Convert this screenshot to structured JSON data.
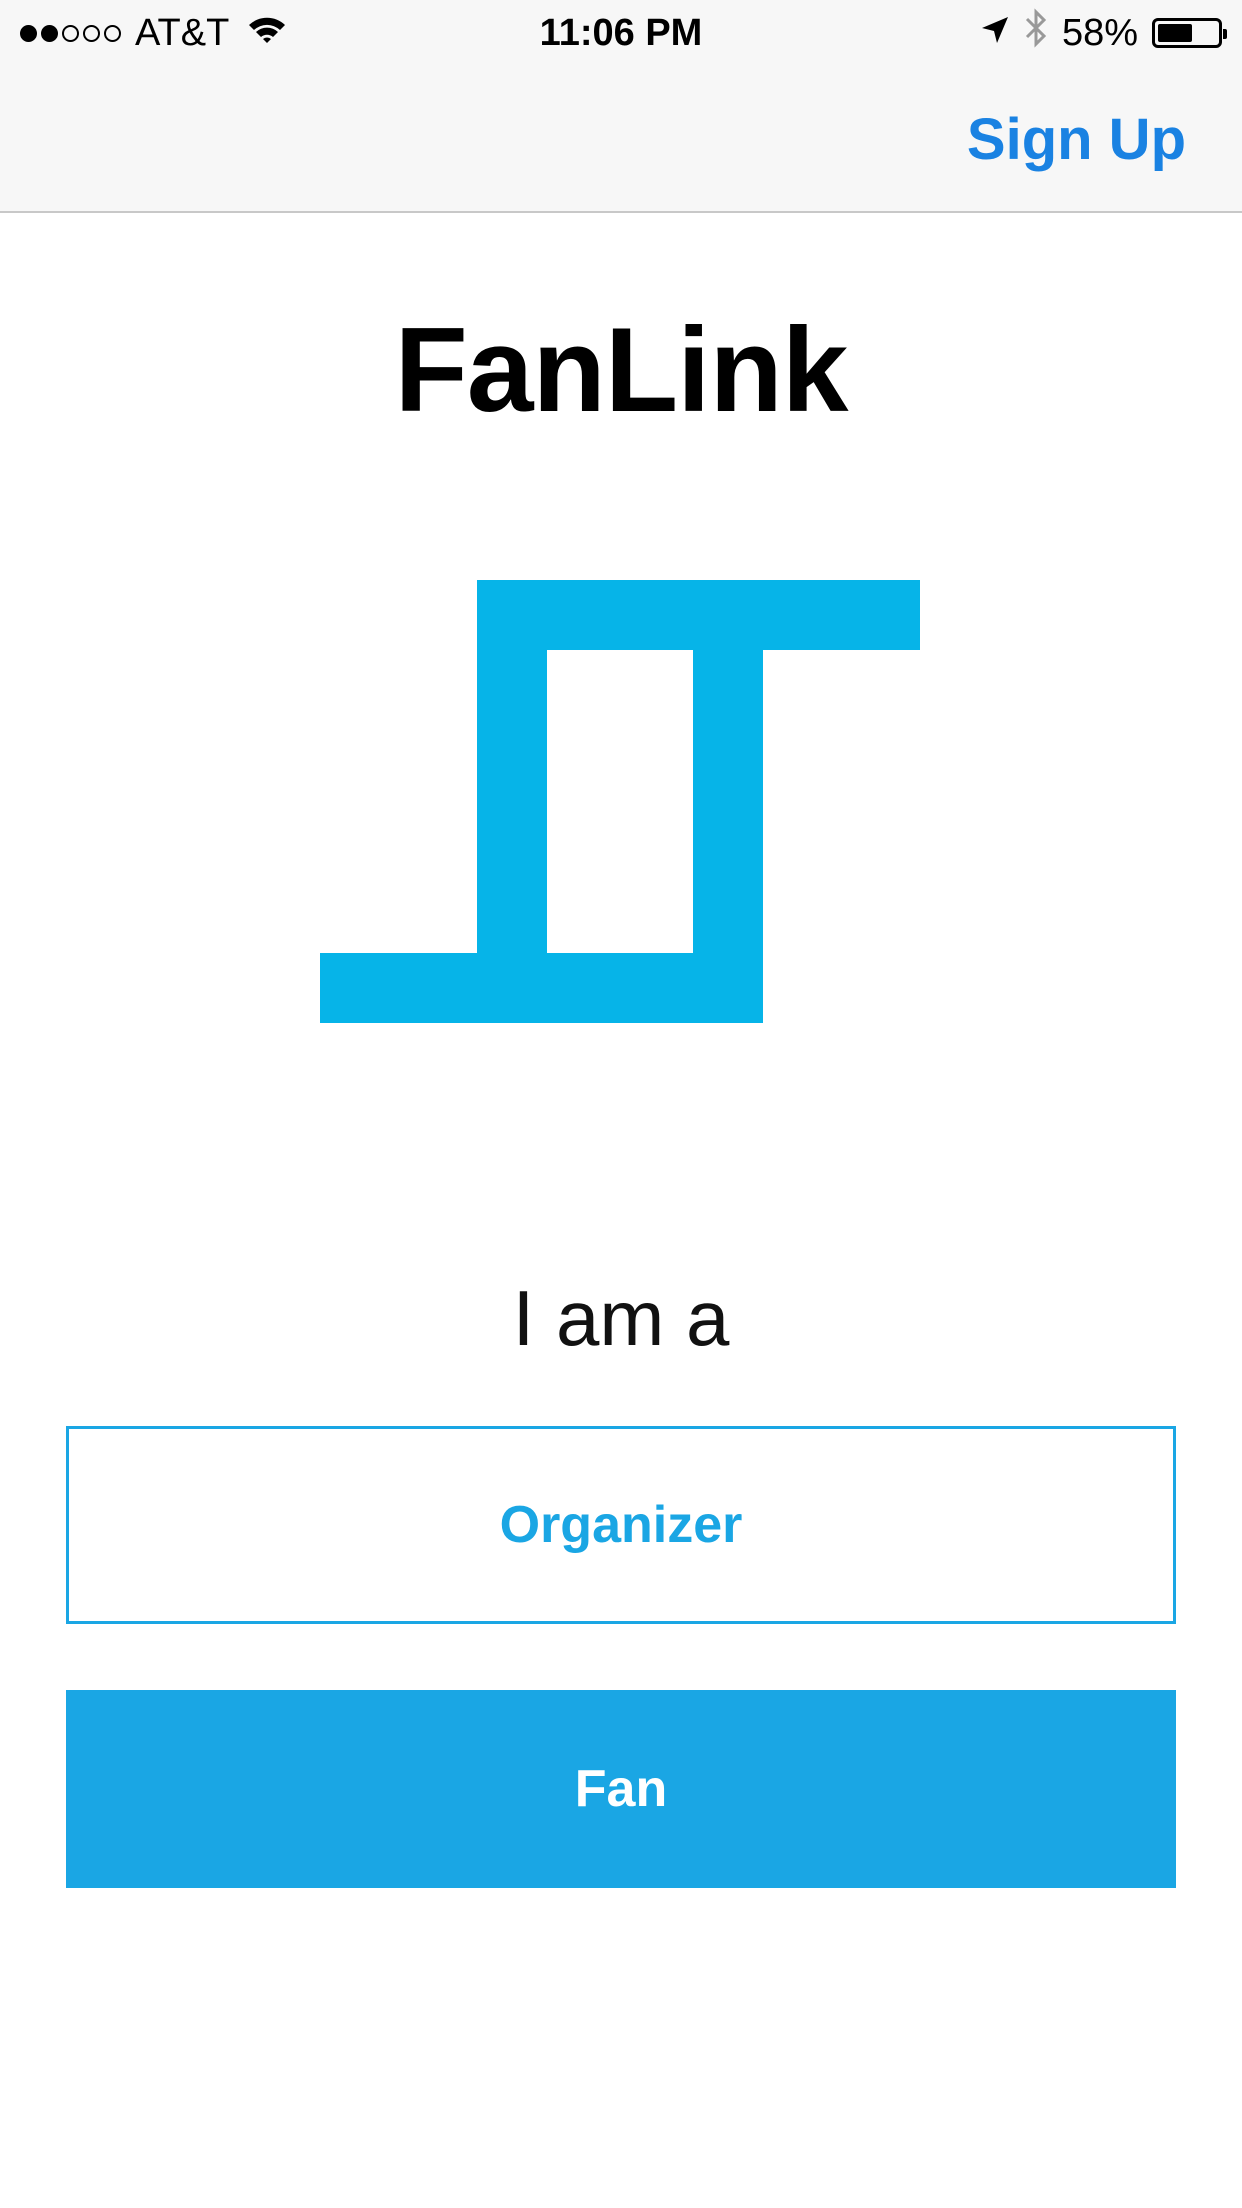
{
  "status_bar": {
    "signal_filled": 2,
    "signal_total": 5,
    "carrier": "AT&T",
    "time": "11:06 PM",
    "battery_percent": "58%",
    "battery_level": 0.58,
    "icons": [
      "wifi-icon",
      "location-arrow-icon",
      "bluetooth-icon",
      "battery-icon"
    ]
  },
  "nav": {
    "sign_up_label": "Sign Up",
    "accent_color": "#1a82e2"
  },
  "main": {
    "app_title": "FanLink",
    "logo_icon": "fanlink-logo-icon",
    "logo_color": "#06b4e8",
    "prompt": "I am a",
    "organizer_label": "Organizer",
    "fan_label": "Fan",
    "button_color": "#1aa6e4"
  }
}
